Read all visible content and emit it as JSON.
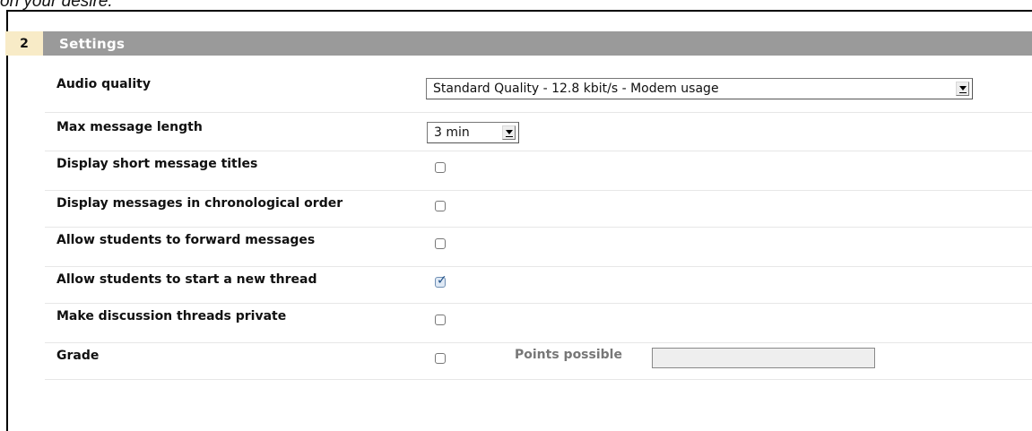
{
  "top_fragment": "on your desire.",
  "section": {
    "number": "2",
    "title": "Settings"
  },
  "settings": {
    "audio_quality": {
      "label": "Audio quality",
      "value": "Standard Quality - 12.8 kbit/s - Modem usage"
    },
    "max_message_length": {
      "label": "Max message length",
      "value": "3 min"
    },
    "display_short_titles": {
      "label": "Display short message titles",
      "checked": false
    },
    "chronological_order": {
      "label": "Display messages in chronological order",
      "checked": false
    },
    "forward_messages": {
      "label": "Allow students to forward messages",
      "checked": false
    },
    "start_thread": {
      "label": "Allow students to start a new thread",
      "checked": true
    },
    "private_threads": {
      "label": "Make discussion threads private",
      "checked": false
    },
    "grade": {
      "label": "Grade",
      "checked": false,
      "points_label": "Points possible",
      "points_value": ""
    }
  },
  "icons": {
    "select_arrow": "chevron-down-icon",
    "checkmark": "checkmark-icon"
  },
  "colors": {
    "section_number_bg": "#f8ebc7",
    "section_title_bg": "#9a9a9a",
    "checked_mark": "#1f4f86"
  }
}
